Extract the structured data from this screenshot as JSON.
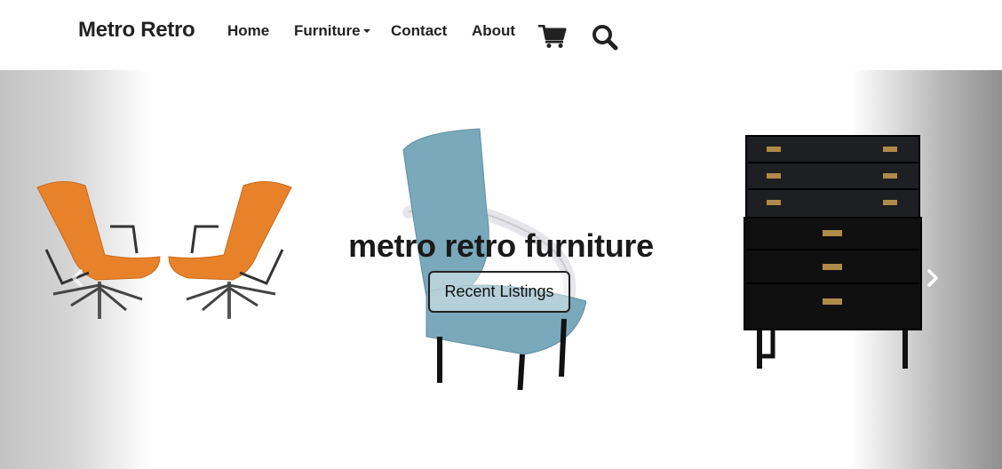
{
  "brand": "Metro Retro",
  "nav": {
    "home": "Home",
    "furniture": "Furniture",
    "contact": "Contact",
    "about": "About"
  },
  "icons": {
    "cart": "shopping-cart-icon",
    "search": "search-icon",
    "prev": "chevron-left-icon",
    "next": "chevron-right-icon"
  },
  "hero": {
    "title": "metro retro furniture",
    "button_label": "Recent Listings"
  },
  "colors": {
    "text": "#222222",
    "chair_orange": "#e8822a",
    "chair_blue": "#79a9bb",
    "dresser_black": "#111111"
  }
}
